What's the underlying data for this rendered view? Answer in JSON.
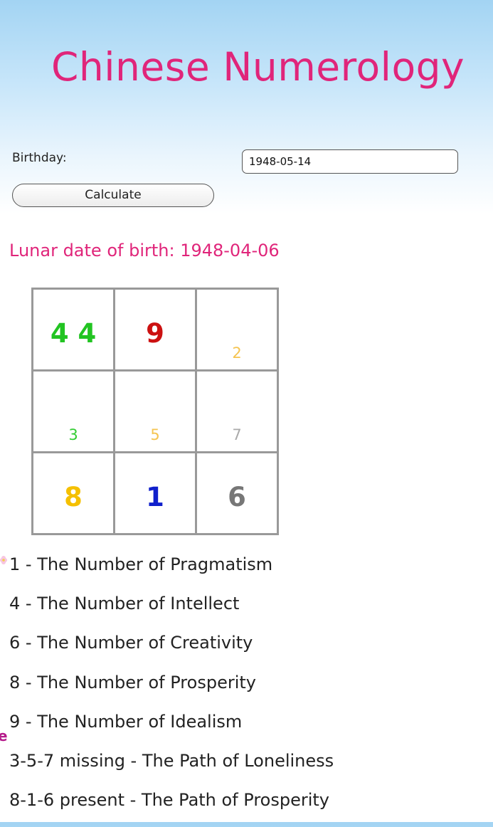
{
  "header": {
    "title": "Chinese Numerology"
  },
  "form": {
    "birthday_label": "Birthday:",
    "birthday_value": "1948-05-14",
    "calculate_label": "Calculate"
  },
  "lunar": {
    "text": "Lunar date of birth: 1948-04-06"
  },
  "grid": {
    "cells": [
      {
        "big": "4 4",
        "small": "",
        "color": "#22c422"
      },
      {
        "big": "9",
        "small": "",
        "color": "#cc1111"
      },
      {
        "big": "",
        "small": "2",
        "color": "#f5c451"
      },
      {
        "big": "",
        "small": "3",
        "color": "#33cc33"
      },
      {
        "big": "",
        "small": "5",
        "color": "#f5c451"
      },
      {
        "big": "",
        "small": "7",
        "color": "#aaaaaa"
      },
      {
        "big": "8",
        "small": "",
        "color": "#f5c000"
      },
      {
        "big": "1",
        "small": "",
        "color": "#1020cc"
      },
      {
        "big": "6",
        "small": "",
        "color": "#777777"
      }
    ]
  },
  "results": [
    "1 - The Number of Pragmatism",
    "4 - The Number of Intellect",
    "6 - The Number of Creativity",
    "8 - The Number of Prosperity",
    "9 - The Number of Idealism",
    "3-5-7 missing - The Path of Loneliness",
    "8-1-6 present - The Path of Prosperity"
  ],
  "decor": {
    "edge_letter": "e",
    "flower_icon": "flower-icon"
  }
}
